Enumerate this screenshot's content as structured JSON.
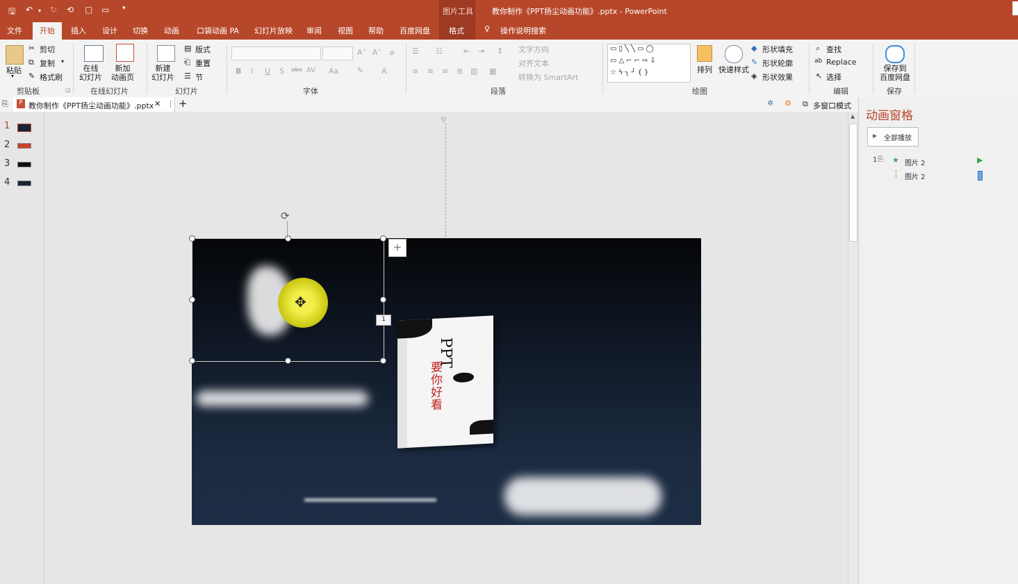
{
  "title_bar": {
    "context_tool": "图片工具",
    "doc_title": "教你制作《PPT扬尘动画功能》.pptx  -  PowerPoint"
  },
  "tabs": [
    "文件",
    "开始",
    "插入",
    "设计",
    "切换",
    "动画",
    "口袋动画 PA",
    "幻灯片放映",
    "审阅",
    "视图",
    "帮助",
    "百度网盘",
    "格式"
  ],
  "tell_me": "操作说明搜索",
  "ribbon": {
    "clipboard": {
      "paste": "粘贴",
      "cut": "剪切",
      "copy": "复制",
      "format_painter": "格式刷",
      "group": "剪贴板"
    },
    "online": {
      "online_slide": "在线\n幻灯片",
      "new_anim_page": "新加\n动画页",
      "group": "在线幻灯片"
    },
    "slides": {
      "new_slide": "新建\n幻灯片",
      "layout": "版式",
      "reset": "重置",
      "section": "节",
      "group": "幻灯片"
    },
    "font": {
      "group": "字体",
      "bold": "B",
      "italic": "I",
      "underline": "U",
      "shadow": "S",
      "strike": "abc",
      "spacing": "AV",
      "case": "Aa",
      "color": "A"
    },
    "paragraph": {
      "group": "段落",
      "text_direction": "文字方向",
      "align_text": "对齐文本",
      "smartart": "转换为 SmartArt"
    },
    "drawing": {
      "group": "绘图",
      "arrange": "排列",
      "quick_styles": "快速样式",
      "shape_fill": "形状填充",
      "shape_outline": "形状轮廓",
      "shape_effects": "形状效果"
    },
    "editing": {
      "group": "编辑",
      "find": "查找",
      "replace": "Replace",
      "select": "选择"
    },
    "save": {
      "group": "保存",
      "save_to_baidu": "保存到\n百度网盘"
    }
  },
  "doc_tab": {
    "name": "教你制作《PPT扬尘动画功能》.pptx",
    "multi_window": "多窗口模式"
  },
  "slides": [
    {
      "num": "1"
    },
    {
      "num": "2"
    },
    {
      "num": "3"
    },
    {
      "num": "4"
    }
  ],
  "anim_pane": {
    "title": "动画窗格",
    "play_all": "全部播放",
    "items": [
      {
        "index": "1",
        "name": "图片 2"
      },
      {
        "index": "",
        "name": "图片 2"
      }
    ]
  },
  "selection": {
    "anim_badge": "1"
  },
  "book": {
    "title": "PPT",
    "subtitle": "要你好看"
  },
  "colors": {
    "accent": "#b7472a",
    "ribbon": "#f3f3f3",
    "pane_title": "#b7472a"
  }
}
